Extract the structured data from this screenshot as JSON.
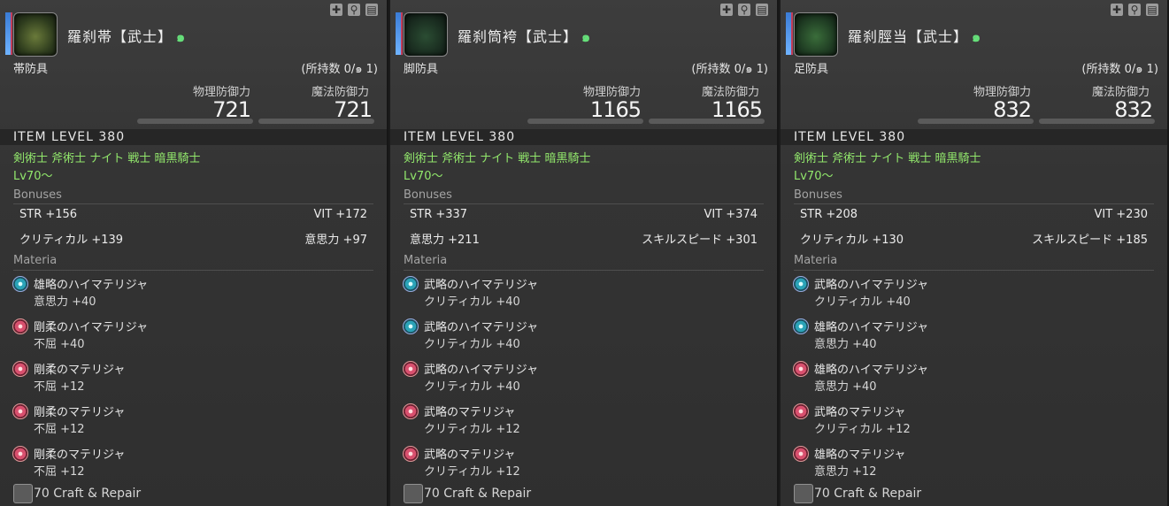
{
  "items": [
    {
      "name": "羅刹帯【武士】",
      "slot": "帯防具",
      "owned": "(所持数 0/",
      "owned_suffix": " 1)",
      "phys_label": "物理防御力",
      "mag_label": "魔法防御力",
      "phys": "721",
      "mag": "721",
      "ilvl": "ITEM LEVEL 380",
      "jobs": "剣術士 斧術士 ナイト 戦士 暗黒騎士",
      "level": "Lv70〜",
      "bonuses_label": "Bonuses",
      "bonuses": [
        [
          "STR +156",
          "VIT +172"
        ],
        [
          "クリティカル +139",
          "意思力 +97"
        ]
      ],
      "materia_label": "Materia",
      "materia": [
        {
          "color": "teal",
          "name": "雄略のハイマテリジャ",
          "stat": "意思力 +40"
        },
        {
          "color": "red",
          "name": "剛柔のハイマテリジャ",
          "stat": "不屈 +40"
        },
        {
          "color": "red",
          "name": "剛柔のマテリジャ",
          "stat": "不屈 +12"
        },
        {
          "color": "red",
          "name": "剛柔のマテリジャ",
          "stat": "不屈 +12"
        },
        {
          "color": "red",
          "name": "剛柔のマテリジャ",
          "stat": "不屈 +12"
        }
      ],
      "craft": "70 Craft & Repair"
    },
    {
      "name": "羅刹筒袴【武士】",
      "slot": "脚防具",
      "owned": "(所持数 0/",
      "owned_suffix": " 1)",
      "phys_label": "物理防御力",
      "mag_label": "魔法防御力",
      "phys": "1165",
      "mag": "1165",
      "ilvl": "ITEM LEVEL 380",
      "jobs": "剣術士 斧術士 ナイト 戦士 暗黒騎士",
      "level": "Lv70〜",
      "bonuses_label": "Bonuses",
      "bonuses": [
        [
          "STR +337",
          "VIT +374"
        ],
        [
          "意思力 +211",
          "スキルスピード +301"
        ]
      ],
      "materia_label": "Materia",
      "materia": [
        {
          "color": "teal",
          "name": "武略のハイマテリジャ",
          "stat": "クリティカル +40"
        },
        {
          "color": "teal",
          "name": "武略のハイマテリジャ",
          "stat": "クリティカル +40"
        },
        {
          "color": "red",
          "name": "武略のハイマテリジャ",
          "stat": "クリティカル +40"
        },
        {
          "color": "red",
          "name": "武略のマテリジャ",
          "stat": "クリティカル +12"
        },
        {
          "color": "red",
          "name": "武略のマテリジャ",
          "stat": "クリティカル +12"
        }
      ],
      "craft": "70 Craft & Repair"
    },
    {
      "name": "羅刹脛当【武士】",
      "slot": "足防具",
      "owned": "(所持数 0/",
      "owned_suffix": " 1)",
      "phys_label": "物理防御力",
      "mag_label": "魔法防御力",
      "phys": "832",
      "mag": "832",
      "ilvl": "ITEM LEVEL 380",
      "jobs": "剣術士 斧術士 ナイト 戦士 暗黒騎士",
      "level": "Lv70〜",
      "bonuses_label": "Bonuses",
      "bonuses": [
        [
          "STR +208",
          "VIT +230"
        ],
        [
          "クリティカル +130",
          "スキルスピード +185"
        ]
      ],
      "materia_label": "Materia",
      "materia": [
        {
          "color": "teal",
          "name": "武略のハイマテリジャ",
          "stat": "クリティカル +40"
        },
        {
          "color": "teal",
          "name": "雄略のハイマテリジャ",
          "stat": "意思力 +40"
        },
        {
          "color": "red",
          "name": "雄略のハイマテリジャ",
          "stat": "意思力 +40"
        },
        {
          "color": "red",
          "name": "武略のマテリジャ",
          "stat": "クリティカル +12"
        },
        {
          "color": "red",
          "name": "雄略のマテリジャ",
          "stat": "意思力 +12"
        }
      ],
      "craft": "70 Craft & Repair"
    }
  ]
}
